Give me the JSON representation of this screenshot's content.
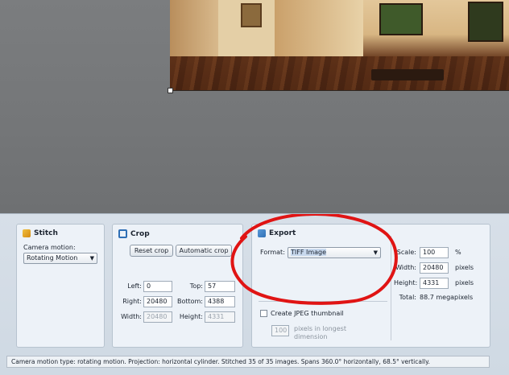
{
  "colors": {
    "annotation": "#e01414",
    "panel_bg": "#d7dfe8",
    "group_bg": "#edf2f8"
  },
  "stitch": {
    "title": "Stitch",
    "icon": "stitch-icon",
    "camera_motion_label": "Camera motion:",
    "camera_motion_value": "Rotating Motion"
  },
  "crop": {
    "title": "Crop",
    "icon": "crop-icon",
    "reset_label": "Reset crop",
    "auto_label": "Automatic crop",
    "left_label": "Left:",
    "left_value": "0",
    "top_label": "Top:",
    "top_value": "57",
    "right_label": "Right:",
    "right_value": "20480",
    "bottom_label": "Bottom:",
    "bottom_value": "4388",
    "width_label": "Width:",
    "width_value": "20480",
    "height_label": "Height:",
    "height_value": "4331"
  },
  "export": {
    "title": "Export",
    "icon": "export-icon",
    "format_label": "Format:",
    "format_value": "TIFF Image",
    "thumbnail_label": "Create JPEG thumbnail",
    "thumbnail_checked": false,
    "thumb_size_value": "100",
    "thumb_size_suffix_1": "pixels in longest",
    "thumb_size_suffix_2": "dimension",
    "scale_label": "Scale:",
    "scale_value": "100",
    "scale_unit": "%",
    "width_label": "Width:",
    "width_value": "20480",
    "width_unit": "pixels",
    "height_label": "Height:",
    "height_value": "4331",
    "height_unit": "pixels",
    "total_label": "Total:",
    "total_value": "88.7 megapixels"
  },
  "status": {
    "text": "Camera motion type: rotating motion. Projection: horizontal cylinder. Stitched 35 of 35 images. Spans 360.0° horizontally, 68.5° vertically."
  }
}
